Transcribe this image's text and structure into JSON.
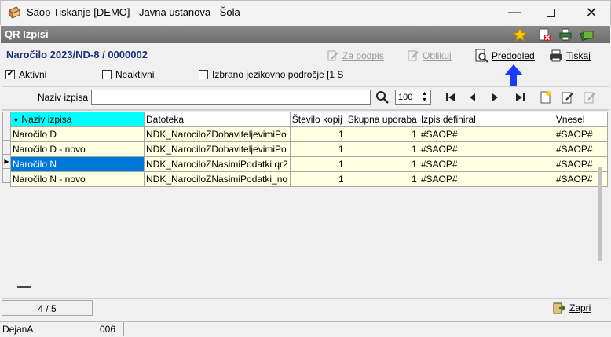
{
  "window": {
    "title": "Saop Tiskanje [DEMO] - Javna ustanova - Šola"
  },
  "panel": {
    "title": "QR Izpisi"
  },
  "header": {
    "order": "Naročilo 2023/ND-8 / 0000002"
  },
  "toolbar": {
    "sign_label": "Za podpis",
    "shape_label": "Oblikuj",
    "preview_label": "Predogled",
    "print_label": "Tiskaj"
  },
  "filters": {
    "active_label": "Aktivni",
    "active_checked": true,
    "inactive_label": "Neaktivni",
    "inactive_checked": false,
    "language_label": "Izbrano jezikovno področje [1 S"
  },
  "search": {
    "label": "Naziv izpisa",
    "value": "",
    "count": "100"
  },
  "table": {
    "columns": [
      "Naziv izpisa",
      "Datoteka",
      "Število kopij",
      "Skupna uporaba",
      "Izpis definiral",
      "Vnesel"
    ],
    "rows": [
      [
        "Naročilo D",
        "NDK_NarociloZDobaviteljevimiPo",
        "1",
        "1",
        "#SAOP#",
        "#SAOP#"
      ],
      [
        "Naročilo D - novo",
        "NDK_NarociloZDobaviteljevimiPo",
        "1",
        "1",
        "#SAOP#",
        "#SAOP#"
      ],
      [
        "Naročilo N",
        "NDK_NarociloZNasimiPodatki.qr2",
        "1",
        "1",
        "#SAOP#",
        "#SAOP#"
      ],
      [
        "Naročilo N - novo",
        "NDK_NarociloZNasimiPodatki_no",
        "1",
        "1",
        "#SAOP#",
        "#SAOP#"
      ]
    ],
    "selected_row": 2
  },
  "footer": {
    "record_position": "4 / 5",
    "close_label": "Zapri"
  },
  "status": {
    "user": "DejanA",
    "code": "006"
  },
  "colors": {
    "accent": "#1c2e7c",
    "selection": "#0078d7",
    "header_sort": "#00ffff",
    "row_bg": "#ffffe1",
    "arrow": "#1a3cff"
  }
}
